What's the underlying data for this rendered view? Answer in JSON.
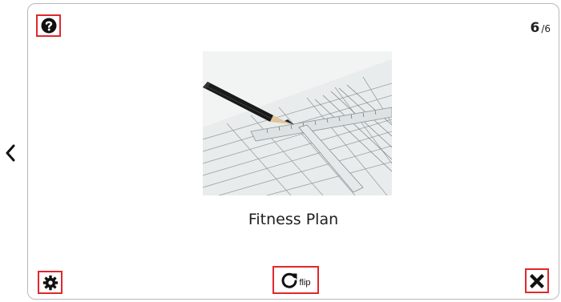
{
  "card": {
    "title": "Fitness Plan",
    "image": {
      "description_icon": "pencil-on-blueprint-image"
    }
  },
  "counter": {
    "current": "6",
    "separator": "/",
    "total": "6"
  },
  "controls": {
    "help_icon": "question-circle-icon",
    "settings_icon": "gear-icon",
    "flip_icon": "rotate-icon",
    "flip_label": "flip",
    "close_icon": "close-icon",
    "prev_icon": "chevron-left-icon"
  },
  "colors": {
    "highlight_border": "#e0282c",
    "card_border": "#b9b9b9",
    "icon": "#111111"
  }
}
